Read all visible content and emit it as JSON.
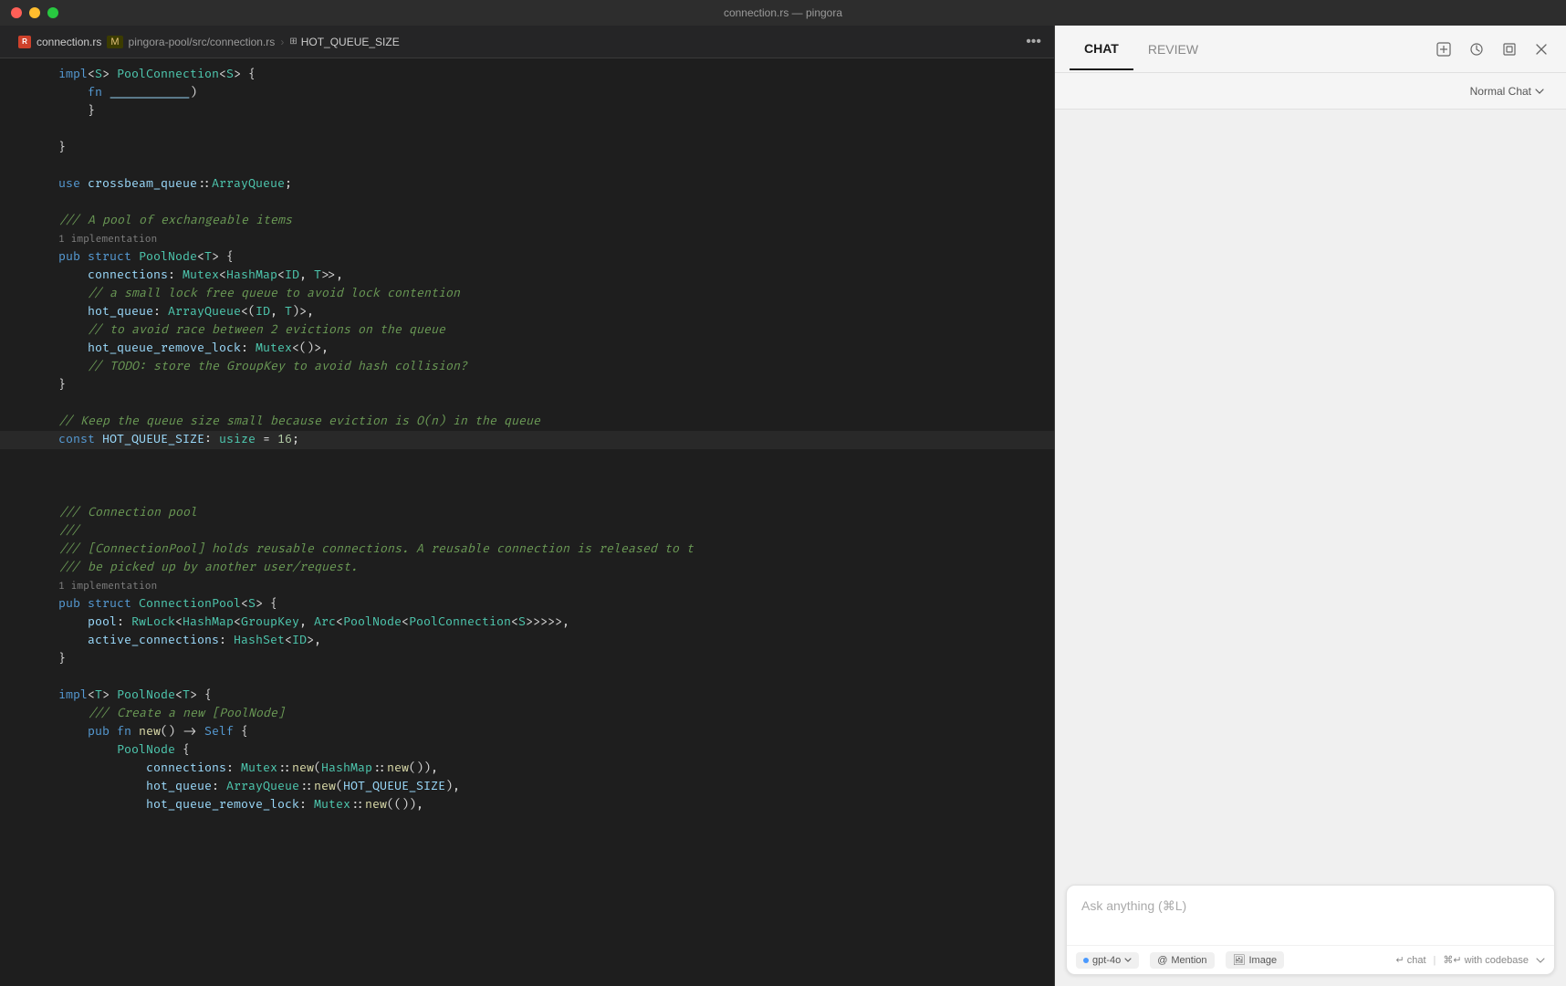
{
  "window": {
    "title": "connection.rs — pingora"
  },
  "tab": {
    "filename": "connection.rs",
    "modified_indicator": "M",
    "breadcrumb": "pingora-pool/src/connection.rs",
    "separator": "›",
    "hotqueue": "HOT_QUEUE_SIZE",
    "more_icon": "•••"
  },
  "chat": {
    "tab_chat": "CHAT",
    "tab_review": "REVIEW",
    "mode_label": "Normal Chat",
    "input_placeholder": "Ask anything (⌘L)",
    "model_label": "gpt-4o",
    "mention_label": "Mention",
    "image_label": "Image",
    "chat_shortcut": "↵ chat",
    "codebase_shortcut": "⌘↵ with codebase"
  },
  "code_lines": [
    {
      "num": "",
      "content": "impl<S> PoolConnection<S> {",
      "type": "mixed"
    },
    {
      "num": "",
      "content": "    fn ___________)",
      "type": "mixed"
    },
    {
      "num": "",
      "content": "}",
      "type": "plain"
    },
    {
      "num": "",
      "content": "",
      "type": "blank"
    },
    {
      "num": "",
      "content": "}",
      "type": "plain"
    },
    {
      "num": "",
      "content": "",
      "type": "blank"
    },
    {
      "num": "",
      "content": "use crossbeam_queue::ArrayQueue;",
      "type": "use"
    },
    {
      "num": "",
      "content": "",
      "type": "blank"
    },
    {
      "num": "",
      "content": "/// A pool of exchangeable items",
      "type": "comment"
    },
    {
      "num": "",
      "content": "1 implementation",
      "type": "impl-hint"
    },
    {
      "num": "",
      "content": "pub struct PoolNode<T> {",
      "type": "mixed"
    },
    {
      "num": "",
      "content": "    connections: Mutex<HashMap<ID, T>>,",
      "type": "field-line"
    },
    {
      "num": "",
      "content": "    // a small lock free queue to avoid lock contention",
      "type": "comment"
    },
    {
      "num": "",
      "content": "    hot_queue: ArrayQueue<(ID, T)>,",
      "type": "field-line"
    },
    {
      "num": "",
      "content": "    // to avoid race between 2 evictions on the queue",
      "type": "comment"
    },
    {
      "num": "",
      "content": "    hot_queue_remove_lock: Mutex<()>,",
      "type": "field-line"
    },
    {
      "num": "",
      "content": "    // TODO: store the GroupKey to avoid hash collision?",
      "type": "comment"
    },
    {
      "num": "",
      "content": "}",
      "type": "plain"
    },
    {
      "num": "",
      "content": "",
      "type": "blank"
    },
    {
      "num": "",
      "content": "// Keep the queue size small because eviction is O(n) in the queue",
      "type": "comment"
    },
    {
      "num": "",
      "content": "const HOT_QUEUE_SIZE: usize = 16;",
      "type": "const-line"
    },
    {
      "num": "",
      "content": "",
      "type": "blank"
    },
    {
      "num": "",
      "content": "",
      "type": "blank"
    },
    {
      "num": "",
      "content": "",
      "type": "blank"
    },
    {
      "num": "",
      "content": "/// Connection pool",
      "type": "comment"
    },
    {
      "num": "",
      "content": "///",
      "type": "comment"
    },
    {
      "num": "",
      "content": "/// [ConnectionPool] holds reusable connections. A reusable connection is released to t",
      "type": "comment"
    },
    {
      "num": "",
      "content": "/// be picked up by another user/request.",
      "type": "comment"
    },
    {
      "num": "",
      "content": "1 implementation",
      "type": "impl-hint"
    },
    {
      "num": "",
      "content": "pub struct ConnectionPool<S> {",
      "type": "mixed"
    },
    {
      "num": "",
      "content": "    pool: RwLock<HashMap<GroupKey, Arc<PoolNode<PoolConnection<S>>>>>,",
      "type": "field-line"
    },
    {
      "num": "",
      "content": "    active_connections: HashSet<ID>,",
      "type": "field-line"
    },
    {
      "num": "",
      "content": "}",
      "type": "plain"
    },
    {
      "num": "",
      "content": "",
      "type": "blank"
    },
    {
      "num": "",
      "content": "impl<T> PoolNode<T> {",
      "type": "mixed"
    },
    {
      "num": "",
      "content": "    /// Create a new [PoolNode]",
      "type": "comment"
    },
    {
      "num": "",
      "content": "    pub fn new() -> Self {",
      "type": "mixed"
    },
    {
      "num": "",
      "content": "        PoolNode {",
      "type": "mixed"
    },
    {
      "num": "",
      "content": "            connections: Mutex::new(HashMap::new()),",
      "type": "field-line"
    },
    {
      "num": "",
      "content": "            hot_queue: ArrayQueue::new(HOT_QUEUE_SIZE),",
      "type": "field-line"
    },
    {
      "num": "",
      "content": "            hot_queue_remove_lock: Mutex::new(()),",
      "type": "field-line"
    }
  ]
}
